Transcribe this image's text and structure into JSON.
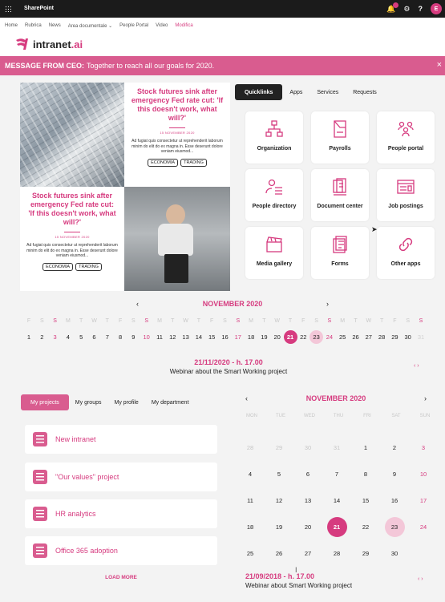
{
  "topbar": {
    "app_name": "SharePoint",
    "help": "?",
    "avatar_initial": "E"
  },
  "nav": {
    "items": [
      "Home",
      "Rubrica",
      "News",
      "Area documentale ⌄",
      "People Portal",
      "Video",
      "Modifica"
    ]
  },
  "logo": {
    "prefix": "intranet",
    "suffix": ".ai"
  },
  "message": {
    "label": "MESSAGE FROM CEO:",
    "text": "Together to reach all our goals for 2020.",
    "close": "×"
  },
  "news": [
    {
      "title": "Stock futures sink after emergency Fed rate cut: 'If this doesn't work, what will?'",
      "date": "15 NOVEMBER 2020",
      "text": "Ad fugiat quis consectetur ut reprehenderit laborum minim do elit do ex magna in. Esse deserunt dolore veniam eiusmod...",
      "tags": [
        "ECONOMIA",
        "TRADING"
      ]
    },
    {
      "title": "Stock futures sink after emergency Fed rate cut: 'If this doesn't work, what will?'",
      "date": "15 NOVEMBER 2020",
      "text": "Ad fugiat quis consectetur ut reprehenderit laborum minim do elit do ex magna in. Esse deserunt dolore veniam eiusmod...",
      "tags": [
        "ECONOMIA",
        "TRADING"
      ]
    }
  ],
  "quicklinks": {
    "tabs": [
      "Quicklinks",
      "Apps",
      "Services",
      "Requests"
    ],
    "tiles": [
      {
        "label": "Organization",
        "icon": "organization-icon"
      },
      {
        "label": "Payrolls",
        "icon": "payrolls-icon"
      },
      {
        "label": "People portal",
        "icon": "people-portal-icon"
      },
      {
        "label": "People directory",
        "icon": "people-directory-icon"
      },
      {
        "label": "Document center",
        "icon": "document-center-icon"
      },
      {
        "label": "Job postings",
        "icon": "job-postings-icon"
      },
      {
        "label": "Media gallery",
        "icon": "media-gallery-icon"
      },
      {
        "label": "Forms",
        "icon": "forms-icon"
      },
      {
        "label": "Other apps",
        "icon": "other-apps-icon"
      }
    ]
  },
  "strip_calendar": {
    "month": "NOVEMBER 2020",
    "prev": "‹",
    "next": "›",
    "weekdays": [
      "F",
      "S",
      "S",
      "M",
      "T",
      "W",
      "T",
      "F",
      "S",
      "S",
      "M",
      "T",
      "W",
      "T",
      "F",
      "S",
      "S",
      "M",
      "T",
      "W",
      "T",
      "F",
      "S",
      "S",
      "M",
      "T",
      "W",
      "T",
      "F",
      "S",
      "S"
    ],
    "days": [
      "1",
      "2",
      "3",
      "4",
      "5",
      "6",
      "7",
      "8",
      "9",
      "10",
      "11",
      "12",
      "13",
      "14",
      "15",
      "16",
      "17",
      "18",
      "19",
      "20",
      "21",
      "22",
      "23",
      "24",
      "25",
      "26",
      "27",
      "28",
      "29",
      "30",
      "31"
    ],
    "selected": "21",
    "highlighted": "23"
  },
  "event_strip": {
    "date": "21/11/2020 - h. 17.00",
    "title": "Webinar about the Smart Working project",
    "arrows": "‹ ›"
  },
  "projects": {
    "tabs": [
      "My projects",
      "My groups",
      "My profile",
      "My department"
    ],
    "items": [
      "New intranet",
      "\"Our values\" project",
      "HR analytics",
      "Office 365 adoption"
    ],
    "load_more": "LOAD MORE"
  },
  "month_calendar": {
    "month": "NOVEMBER 2020",
    "prev": "‹",
    "next": "›",
    "weekdays": [
      "MON",
      "TUE",
      "WED",
      "THU",
      "FRI",
      "SAT",
      "SUN"
    ],
    "weeks": [
      [
        "28",
        "29",
        "30",
        "31",
        "1",
        "2",
        "3"
      ],
      [
        "4",
        "5",
        "6",
        "7",
        "8",
        "9",
        "10"
      ],
      [
        "11",
        "12",
        "13",
        "14",
        "15",
        "16",
        "17"
      ],
      [
        "18",
        "19",
        "20",
        "21",
        "22",
        "23",
        "24"
      ],
      [
        "25",
        "26",
        "27",
        "28",
        "29",
        "30",
        ""
      ]
    ],
    "selected": "21",
    "highlighted": "23"
  },
  "event_month": {
    "date": "21/09/2018 - h. 17.00",
    "title": "Webinar about Smart Working project",
    "arrows": "‹ ›"
  },
  "colors": {
    "accent": "#d63b7f",
    "accent_light": "#f3c7d8",
    "topbar": "#1b1b1b"
  }
}
